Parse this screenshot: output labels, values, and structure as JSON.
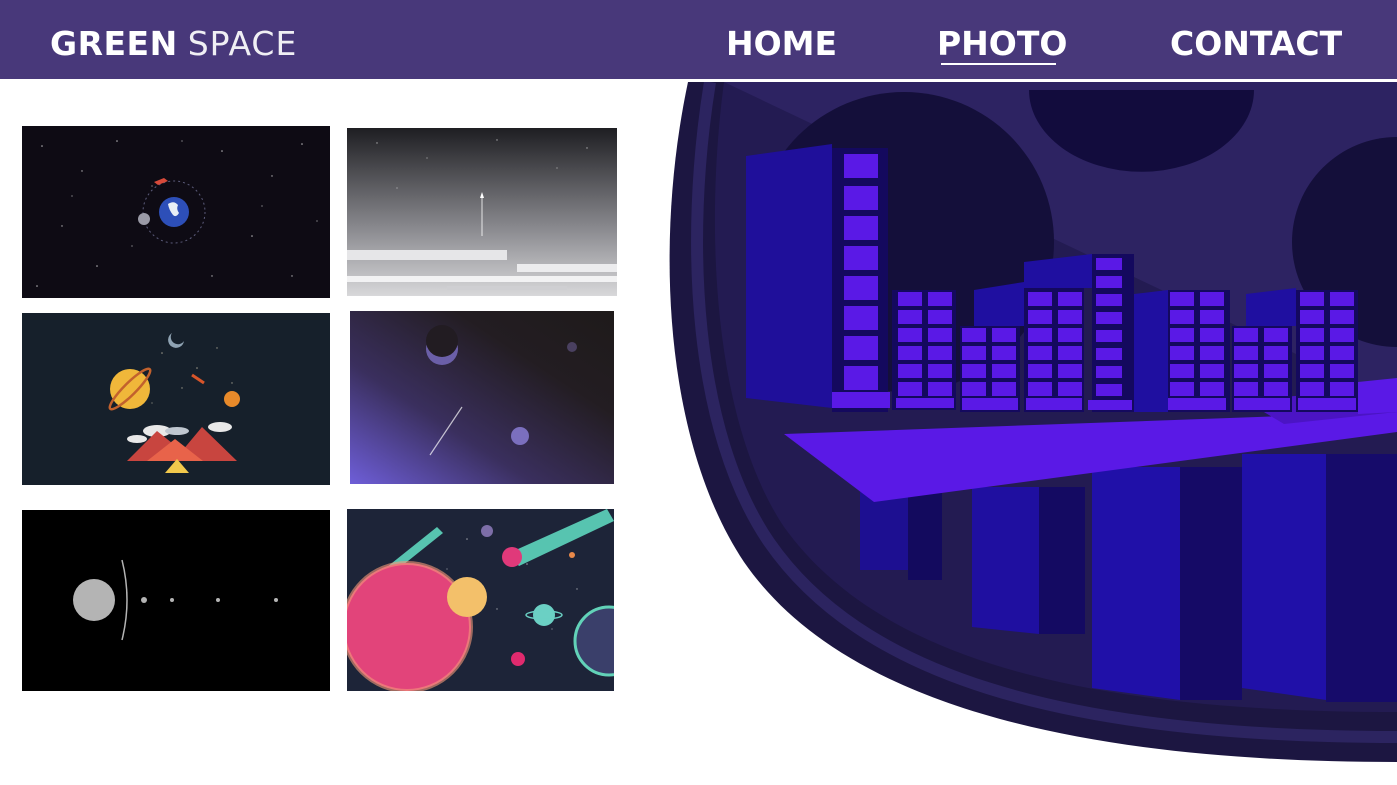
{
  "brand": {
    "bold": "GREEN",
    "light": "SPACE"
  },
  "nav": {
    "items": [
      {
        "label": "HOME"
      },
      {
        "label": "PHOTO",
        "active": true
      },
      {
        "label": "CONTACT"
      }
    ]
  },
  "colors": {
    "navbar": "#48387a",
    "accent": "#5a19e6",
    "hero_dark": "#1a1445"
  },
  "gallery": {
    "thumbnails": [
      {
        "subject": "earth-orbit-rocket"
      },
      {
        "subject": "rocket-launch-grey-sky"
      },
      {
        "subject": "planets-mountains-ufo"
      },
      {
        "subject": "purple-planet-horizon"
      },
      {
        "subject": "sun-and-planets-row"
      },
      {
        "subject": "colorful-planets-comets"
      }
    ]
  },
  "hero": {
    "subject": "city-on-floating-platform"
  }
}
